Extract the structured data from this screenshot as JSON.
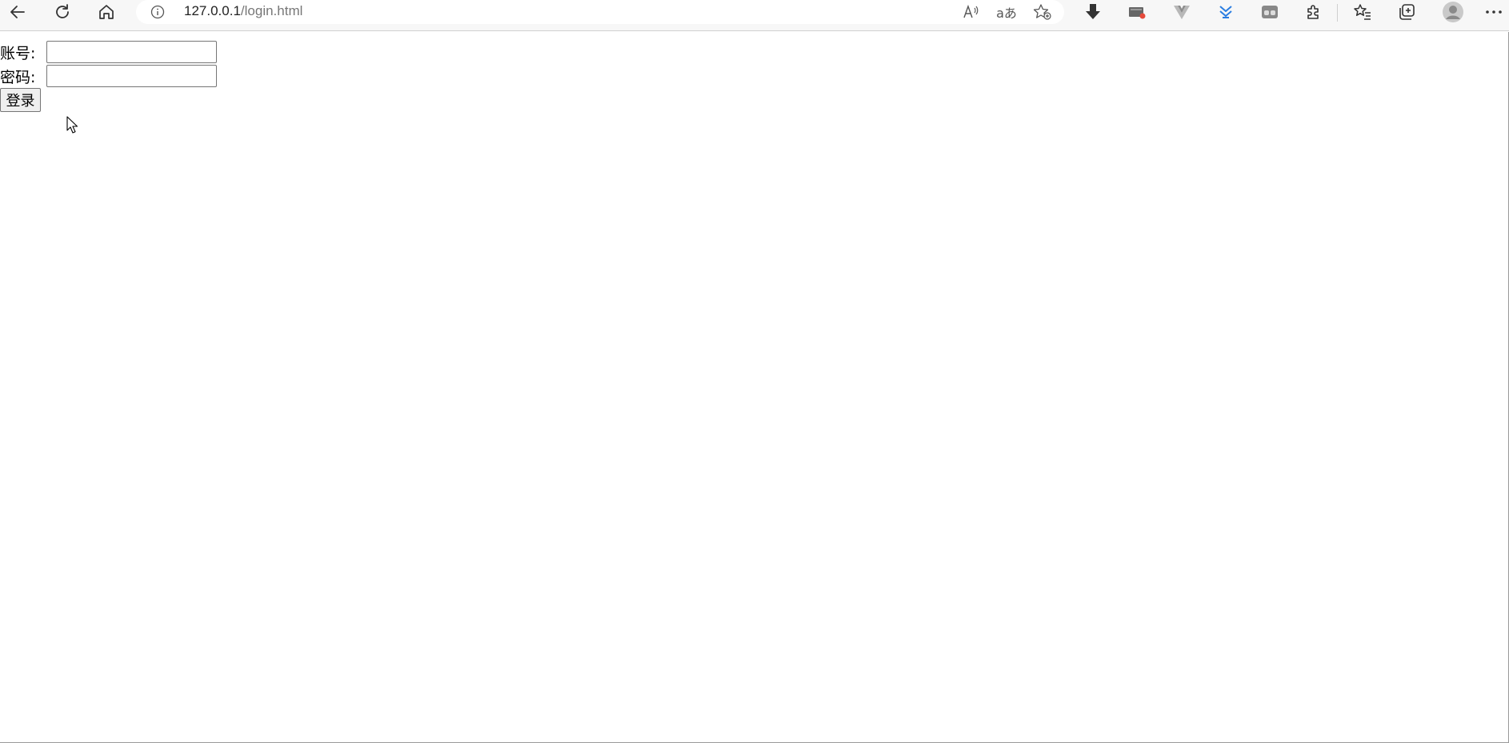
{
  "browser": {
    "url_host": "127.0.0.1",
    "url_path": "/login.html",
    "read_aloud_icon": "read-aloud-icon",
    "translate_glyph": "aあ"
  },
  "form": {
    "account_label": "账号:",
    "account_value": "",
    "password_label": "密码:",
    "password_value": "",
    "login_button": "登录"
  }
}
